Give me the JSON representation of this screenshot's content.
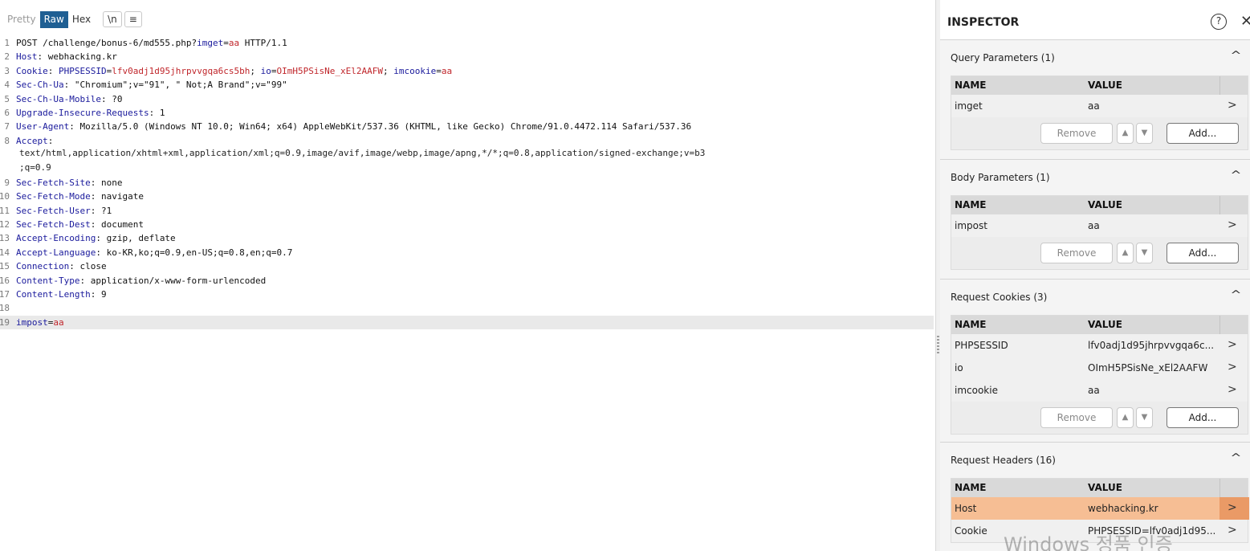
{
  "toolbar": {
    "pretty": "Pretty",
    "raw": "Raw",
    "hex": "Hex",
    "newline": "\\n",
    "menu": "≡"
  },
  "request_lines": [
    {
      "num": "1",
      "parts": [
        {
          "t": "POST /challenge/bonus-6/md555.php?",
          "c": ""
        },
        {
          "t": "imget",
          "c": "k"
        },
        {
          "t": "=",
          "c": ""
        },
        {
          "t": "aa",
          "c": "v"
        },
        {
          "t": " HTTP/1.1",
          "c": ""
        }
      ]
    },
    {
      "num": "2",
      "parts": [
        {
          "t": "Host",
          "c": "k"
        },
        {
          "t": ": webhacking.kr",
          "c": ""
        }
      ]
    },
    {
      "num": "3",
      "parts": [
        {
          "t": "Cookie",
          "c": "k"
        },
        {
          "t": ": ",
          "c": ""
        },
        {
          "t": "PHPSESSID",
          "c": "k"
        },
        {
          "t": "=",
          "c": ""
        },
        {
          "t": "lfv0adj1d95jhrpvvgqa6cs5bh",
          "c": "v"
        },
        {
          "t": "; ",
          "c": ""
        },
        {
          "t": "io",
          "c": "k"
        },
        {
          "t": "=",
          "c": ""
        },
        {
          "t": "OImH5PSisNe_xEl2AAFW",
          "c": "v"
        },
        {
          "t": "; ",
          "c": ""
        },
        {
          "t": "imcookie",
          "c": "k"
        },
        {
          "t": "=",
          "c": ""
        },
        {
          "t": "aa",
          "c": "v"
        }
      ]
    },
    {
      "num": "4",
      "parts": [
        {
          "t": "Sec-Ch-Ua",
          "c": "k"
        },
        {
          "t": ": \"Chromium\";v=\"91\", \" Not;A Brand\";v=\"99\"",
          "c": ""
        }
      ]
    },
    {
      "num": "5",
      "parts": [
        {
          "t": "Sec-Ch-Ua-Mobile",
          "c": "k"
        },
        {
          "t": ": ?0",
          "c": ""
        }
      ]
    },
    {
      "num": "6",
      "parts": [
        {
          "t": "Upgrade-Insecure-Requests",
          "c": "k"
        },
        {
          "t": ": 1",
          "c": ""
        }
      ]
    },
    {
      "num": "7",
      "parts": [
        {
          "t": "User-Agent",
          "c": "k"
        },
        {
          "t": ": Mozilla/5.0 (Windows NT 10.0; Win64; x64) AppleWebKit/537.36 (KHTML, like Gecko) Chrome/91.0.4472.114 Safari/537.36",
          "c": ""
        }
      ]
    },
    {
      "num": "8",
      "parts": [
        {
          "t": "Accept",
          "c": "k"
        },
        {
          "t": ":",
          "c": ""
        }
      ],
      "continuation": [
        "text/html,application/xhtml+xml,application/xml;q=0.9,image/avif,image/webp,image/apng,*/*;q=0.8,application/signed-exchange;v=b3",
        ";q=0.9"
      ]
    },
    {
      "num": "9",
      "parts": [
        {
          "t": "Sec-Fetch-Site",
          "c": "k"
        },
        {
          "t": ": none",
          "c": ""
        }
      ]
    },
    {
      "num": "10",
      "parts": [
        {
          "t": "Sec-Fetch-Mode",
          "c": "k"
        },
        {
          "t": ": navigate",
          "c": ""
        }
      ]
    },
    {
      "num": "11",
      "parts": [
        {
          "t": "Sec-Fetch-User",
          "c": "k"
        },
        {
          "t": ": ?1",
          "c": ""
        }
      ]
    },
    {
      "num": "12",
      "parts": [
        {
          "t": "Sec-Fetch-Dest",
          "c": "k"
        },
        {
          "t": ": document",
          "c": ""
        }
      ]
    },
    {
      "num": "13",
      "parts": [
        {
          "t": "Accept-Encoding",
          "c": "k"
        },
        {
          "t": ": gzip, deflate",
          "c": ""
        }
      ]
    },
    {
      "num": "14",
      "parts": [
        {
          "t": "Accept-Language",
          "c": "k"
        },
        {
          "t": ": ko-KR,ko;q=0.9,en-US;q=0.8,en;q=0.7",
          "c": ""
        }
      ]
    },
    {
      "num": "15",
      "parts": [
        {
          "t": "Connection",
          "c": "k"
        },
        {
          "t": ": close",
          "c": ""
        }
      ]
    },
    {
      "num": "16",
      "parts": [
        {
          "t": "Content-Type",
          "c": "k"
        },
        {
          "t": ": application/x-www-form-urlencoded",
          "c": ""
        }
      ]
    },
    {
      "num": "17",
      "parts": [
        {
          "t": "Content-Length",
          "c": "k"
        },
        {
          "t": ": 9",
          "c": ""
        }
      ]
    },
    {
      "num": "18",
      "parts": []
    },
    {
      "num": "19",
      "parts": [
        {
          "t": "impost",
          "c": "k"
        },
        {
          "t": "=",
          "c": ""
        },
        {
          "t": "aa",
          "c": "v"
        }
      ],
      "current": true
    }
  ],
  "inspector": {
    "title": "INSPECTOR",
    "help_icon": "?",
    "close_icon": "✕",
    "col_name": "NAME",
    "col_value": "VALUE",
    "btn_remove": "Remove",
    "btn_add": "Add...",
    "sections": [
      {
        "title": "Query Parameters (1)",
        "rows": [
          {
            "name": "imget",
            "value": "aa"
          }
        ]
      },
      {
        "title": "Body Parameters (1)",
        "rows": [
          {
            "name": "impost",
            "value": "aa"
          }
        ]
      },
      {
        "title": "Request Cookies (3)",
        "rows": [
          {
            "name": "PHPSESSID",
            "value": "lfv0adj1d95jhrpvvgqa6c..."
          },
          {
            "name": "io",
            "value": "OImH5PSisNe_xEl2AAFW"
          },
          {
            "name": "imcookie",
            "value": "aa"
          }
        ]
      },
      {
        "title": "Request Headers (16)",
        "rows": [
          {
            "name": "Host",
            "value": "webhacking.kr",
            "highlight": true
          },
          {
            "name": "Cookie",
            "value": "PHPSESSID=lfv0adj1d95..."
          }
        ]
      }
    ]
  },
  "watermark": "Windows 정품 인증",
  "colors": {
    "accent": "#1f5f93",
    "key": "#1a1a9c",
    "value": "#c0262b",
    "highlight_row": "#f6be94"
  }
}
